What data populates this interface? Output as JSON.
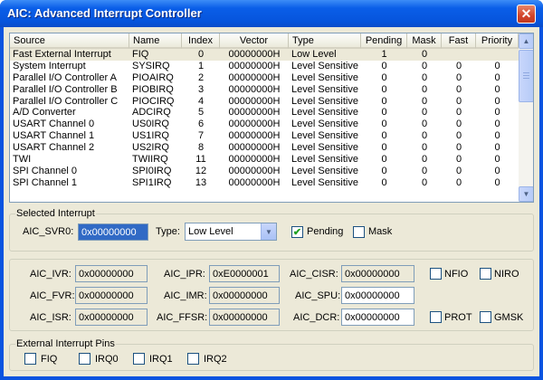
{
  "window": {
    "title": "AIC: Advanced Interrupt Controller",
    "close_glyph": "✕"
  },
  "table": {
    "headers": [
      "Source",
      "Name",
      "Index",
      "Vector",
      "Type",
      "Pending",
      "Mask",
      "Fast",
      "Priority"
    ],
    "rows": [
      [
        "Fast External Interrupt",
        "FIQ",
        "0",
        "00000000H",
        "Low Level",
        "1",
        "0",
        "",
        ""
      ],
      [
        "System Interrupt",
        "SYSIRQ",
        "1",
        "00000000H",
        "Level Sensitive",
        "0",
        "0",
        "0",
        "0"
      ],
      [
        "Parallel I/O Controller A",
        "PIOAIRQ",
        "2",
        "00000000H",
        "Level Sensitive",
        "0",
        "0",
        "0",
        "0"
      ],
      [
        "Parallel I/O Controller B",
        "PIOBIRQ",
        "3",
        "00000000H",
        "Level Sensitive",
        "0",
        "0",
        "0",
        "0"
      ],
      [
        "Parallel I/O Controller C",
        "PIOCIRQ",
        "4",
        "00000000H",
        "Level Sensitive",
        "0",
        "0",
        "0",
        "0"
      ],
      [
        "A/D Converter",
        "ADCIRQ",
        "5",
        "00000000H",
        "Level Sensitive",
        "0",
        "0",
        "0",
        "0"
      ],
      [
        "USART Channel 0",
        "US0IRQ",
        "6",
        "00000000H",
        "Level Sensitive",
        "0",
        "0",
        "0",
        "0"
      ],
      [
        "USART Channel 1",
        "US1IRQ",
        "7",
        "00000000H",
        "Level Sensitive",
        "0",
        "0",
        "0",
        "0"
      ],
      [
        "USART Channel 2",
        "US2IRQ",
        "8",
        "00000000H",
        "Level Sensitive",
        "0",
        "0",
        "0",
        "0"
      ],
      [
        "TWI",
        "TWIIRQ",
        "11",
        "00000000H",
        "Level Sensitive",
        "0",
        "0",
        "0",
        "0"
      ],
      [
        "SPI Channel 0",
        "SPI0IRQ",
        "12",
        "00000000H",
        "Level Sensitive",
        "0",
        "0",
        "0",
        "0"
      ],
      [
        "SPI Channel 1",
        "SPI1IRQ",
        "13",
        "00000000H",
        "Level Sensitive",
        "0",
        "0",
        "0",
        "0"
      ]
    ],
    "selected_row": 0
  },
  "selected_interrupt": {
    "label": "Selected Interrupt",
    "svr_label": "AIC_SVR0:",
    "svr_value": "0x00000000",
    "type_label": "Type:",
    "type_value": "Low Level",
    "pending_label": "Pending",
    "pending_checked": "✔",
    "mask_label": "Mask",
    "mask_checked": ""
  },
  "registers": {
    "ivr_label": "AIC_IVR:",
    "ivr_value": "0x00000000",
    "fvr_label": "AIC_FVR:",
    "fvr_value": "0x00000000",
    "isr_label": "AIC_ISR:",
    "isr_value": "0x00000000",
    "ipr_label": "AIC_IPR:",
    "ipr_value": "0xE0000001",
    "imr_label": "AIC_IMR:",
    "imr_value": "0x00000000",
    "ffsr_label": "AIC_FFSR:",
    "ffsr_value": "0x00000000",
    "cisr_label": "AIC_CISR:",
    "cisr_value": "0x00000000",
    "spu_label": "AIC_SPU:",
    "spu_value": "0x00000000",
    "dcr_label": "AIC_DCR:",
    "dcr_value": "0x00000000",
    "nfio_label": "NFIO",
    "niro_label": "NIRO",
    "prot_label": "PROT",
    "gmsk_label": "GMSK"
  },
  "external_pins": {
    "label": "External Interrupt Pins",
    "fiq_label": "FIQ",
    "irq0_label": "IRQ0",
    "irq1_label": "IRQ1",
    "irq2_label": "IRQ2"
  },
  "scrollbar": {
    "up_glyph": "▲",
    "down_glyph": "▼"
  },
  "combo": {
    "arrow_glyph": "▼"
  }
}
